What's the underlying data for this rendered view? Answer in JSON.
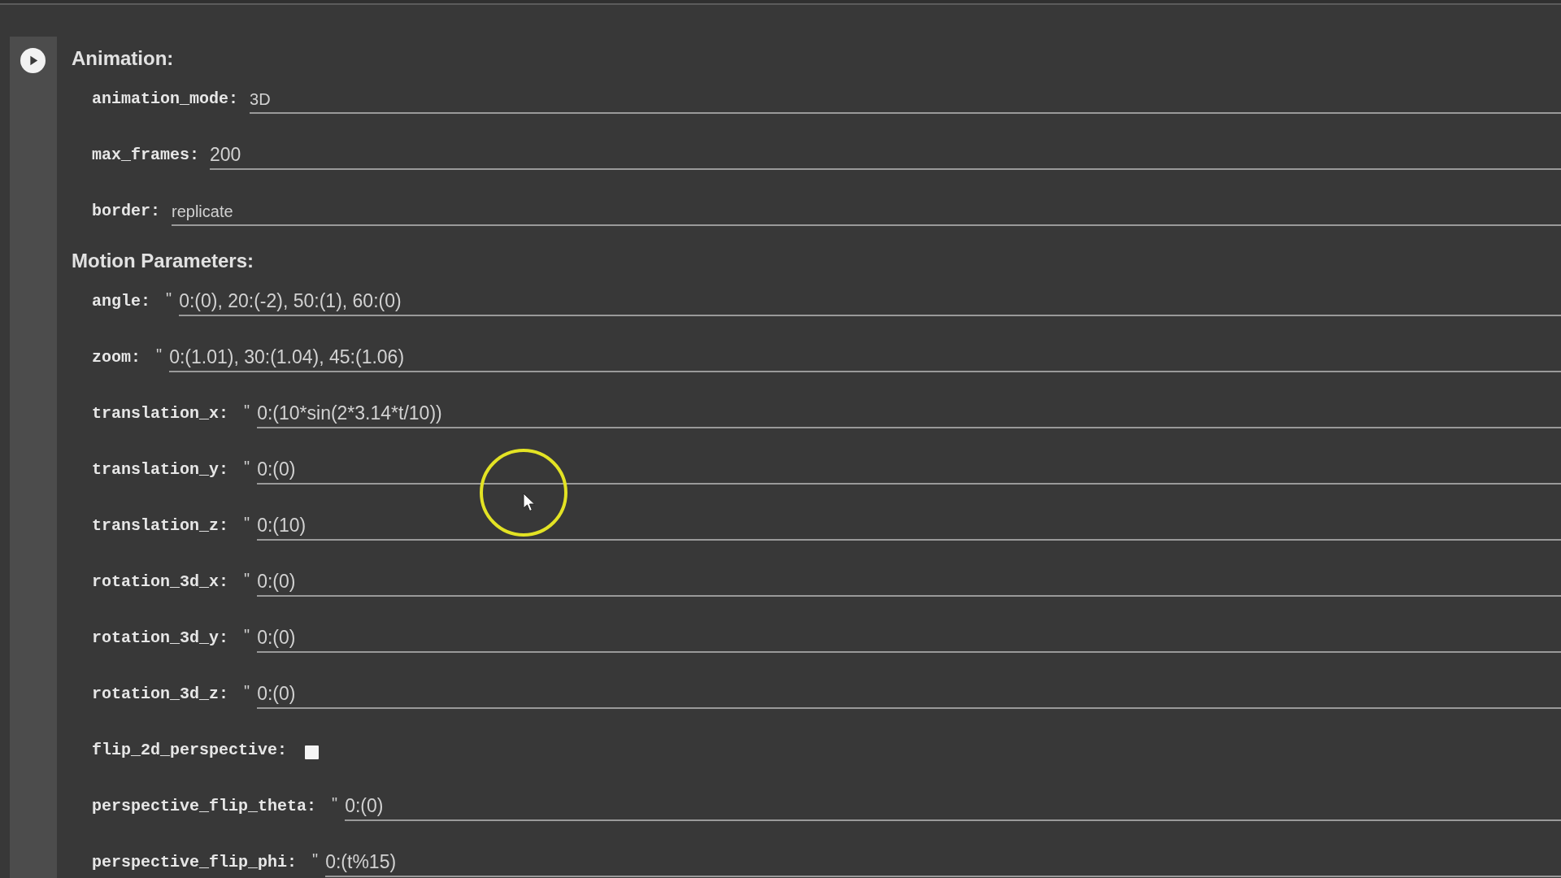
{
  "sections": [
    {
      "title": "Animation:",
      "fields": [
        {
          "kind": "dropdown",
          "label": "animation_mode:",
          "value": "3D"
        },
        {
          "kind": "number",
          "label": "max_frames:",
          "value": "200"
        },
        {
          "kind": "dropdown",
          "label": "border:",
          "value": "replicate"
        }
      ]
    },
    {
      "title": "Motion Parameters:",
      "fields": [
        {
          "kind": "text",
          "label": "angle:",
          "prefix": "\"",
          "value": "0:(0), 20:(-2), 50:(1), 60:(0)"
        },
        {
          "kind": "text",
          "label": "zoom:",
          "prefix": "\"",
          "value": "0:(1.01), 30:(1.04), 45:(1.06)"
        },
        {
          "kind": "text",
          "label": "translation_x:",
          "prefix": "\"",
          "value": "0:(10*sin(2*3.14*t/10))"
        },
        {
          "kind": "text",
          "label": "translation_y:",
          "prefix": "\"",
          "value": "0:(0)"
        },
        {
          "kind": "text",
          "label": "translation_z:",
          "prefix": "\"",
          "value": "0:(10)"
        },
        {
          "kind": "text",
          "label": "rotation_3d_x:",
          "prefix": "\"",
          "value": "0:(0)"
        },
        {
          "kind": "text",
          "label": "rotation_3d_y:",
          "prefix": "\"",
          "value": "0:(0)"
        },
        {
          "kind": "text",
          "label": "rotation_3d_z:",
          "prefix": "\"",
          "value": "0:(0)"
        },
        {
          "kind": "checkbox",
          "label": "flip_2d_perspective:",
          "checked": false
        },
        {
          "kind": "text",
          "label": "perspective_flip_theta:",
          "prefix": "\"",
          "value": "0:(0)"
        },
        {
          "kind": "text",
          "label": "perspective_flip_phi:",
          "prefix": "\"",
          "value": "0:(t%15)"
        }
      ]
    }
  ]
}
